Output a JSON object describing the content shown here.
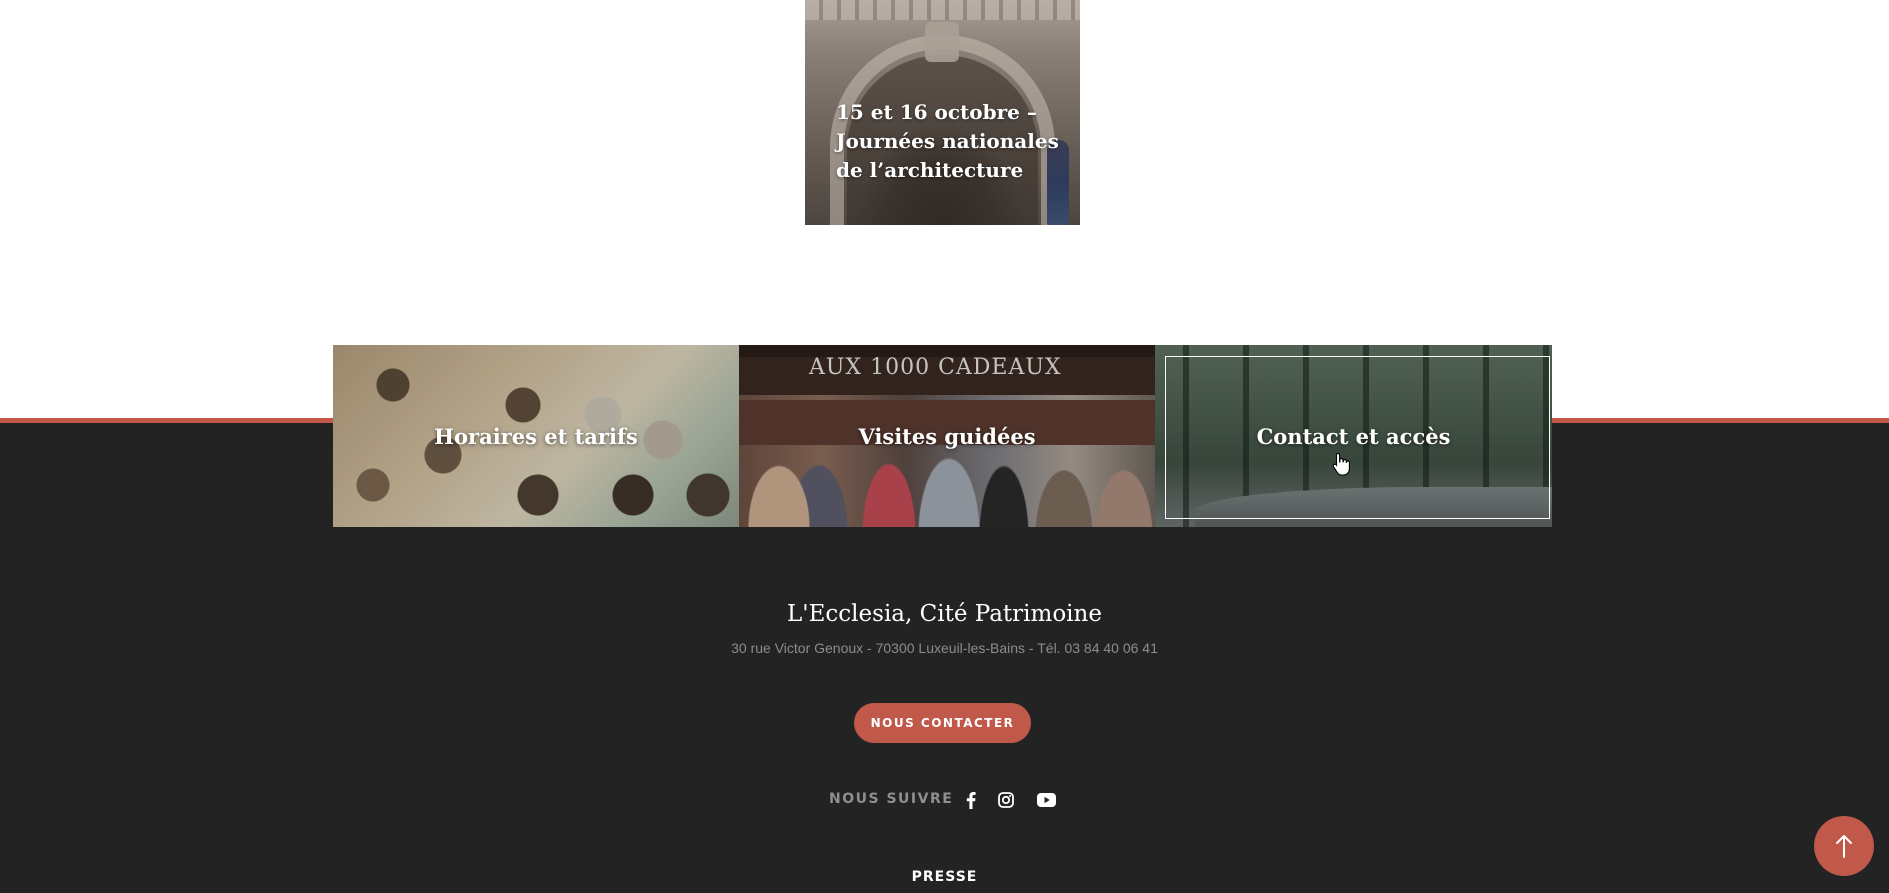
{
  "event": {
    "title": "15 et 16 octobre – Journées nationales de l’architecture"
  },
  "tiles": [
    {
      "label": "Horaires et tarifs"
    },
    {
      "label": "Visites guidées",
      "sign_text": "AUX 1000 CADEAUX"
    },
    {
      "label": "Contact et accès"
    }
  ],
  "footer": {
    "site_name": "L'Ecclesia, Cité Patrimoine",
    "address": "30 rue Victor Genoux - 70300 Luxeuil-les-Bains - Tél. 03 84 40 06 41",
    "contact_button": "NOUS CONTACTER",
    "follow_label": "NOUS SUIVRE",
    "social": [
      "facebook-icon",
      "instagram-icon",
      "youtube-icon"
    ],
    "press_label": "PRESSE"
  },
  "colors": {
    "accent": "#c0594a",
    "footer_bg": "#232323"
  }
}
